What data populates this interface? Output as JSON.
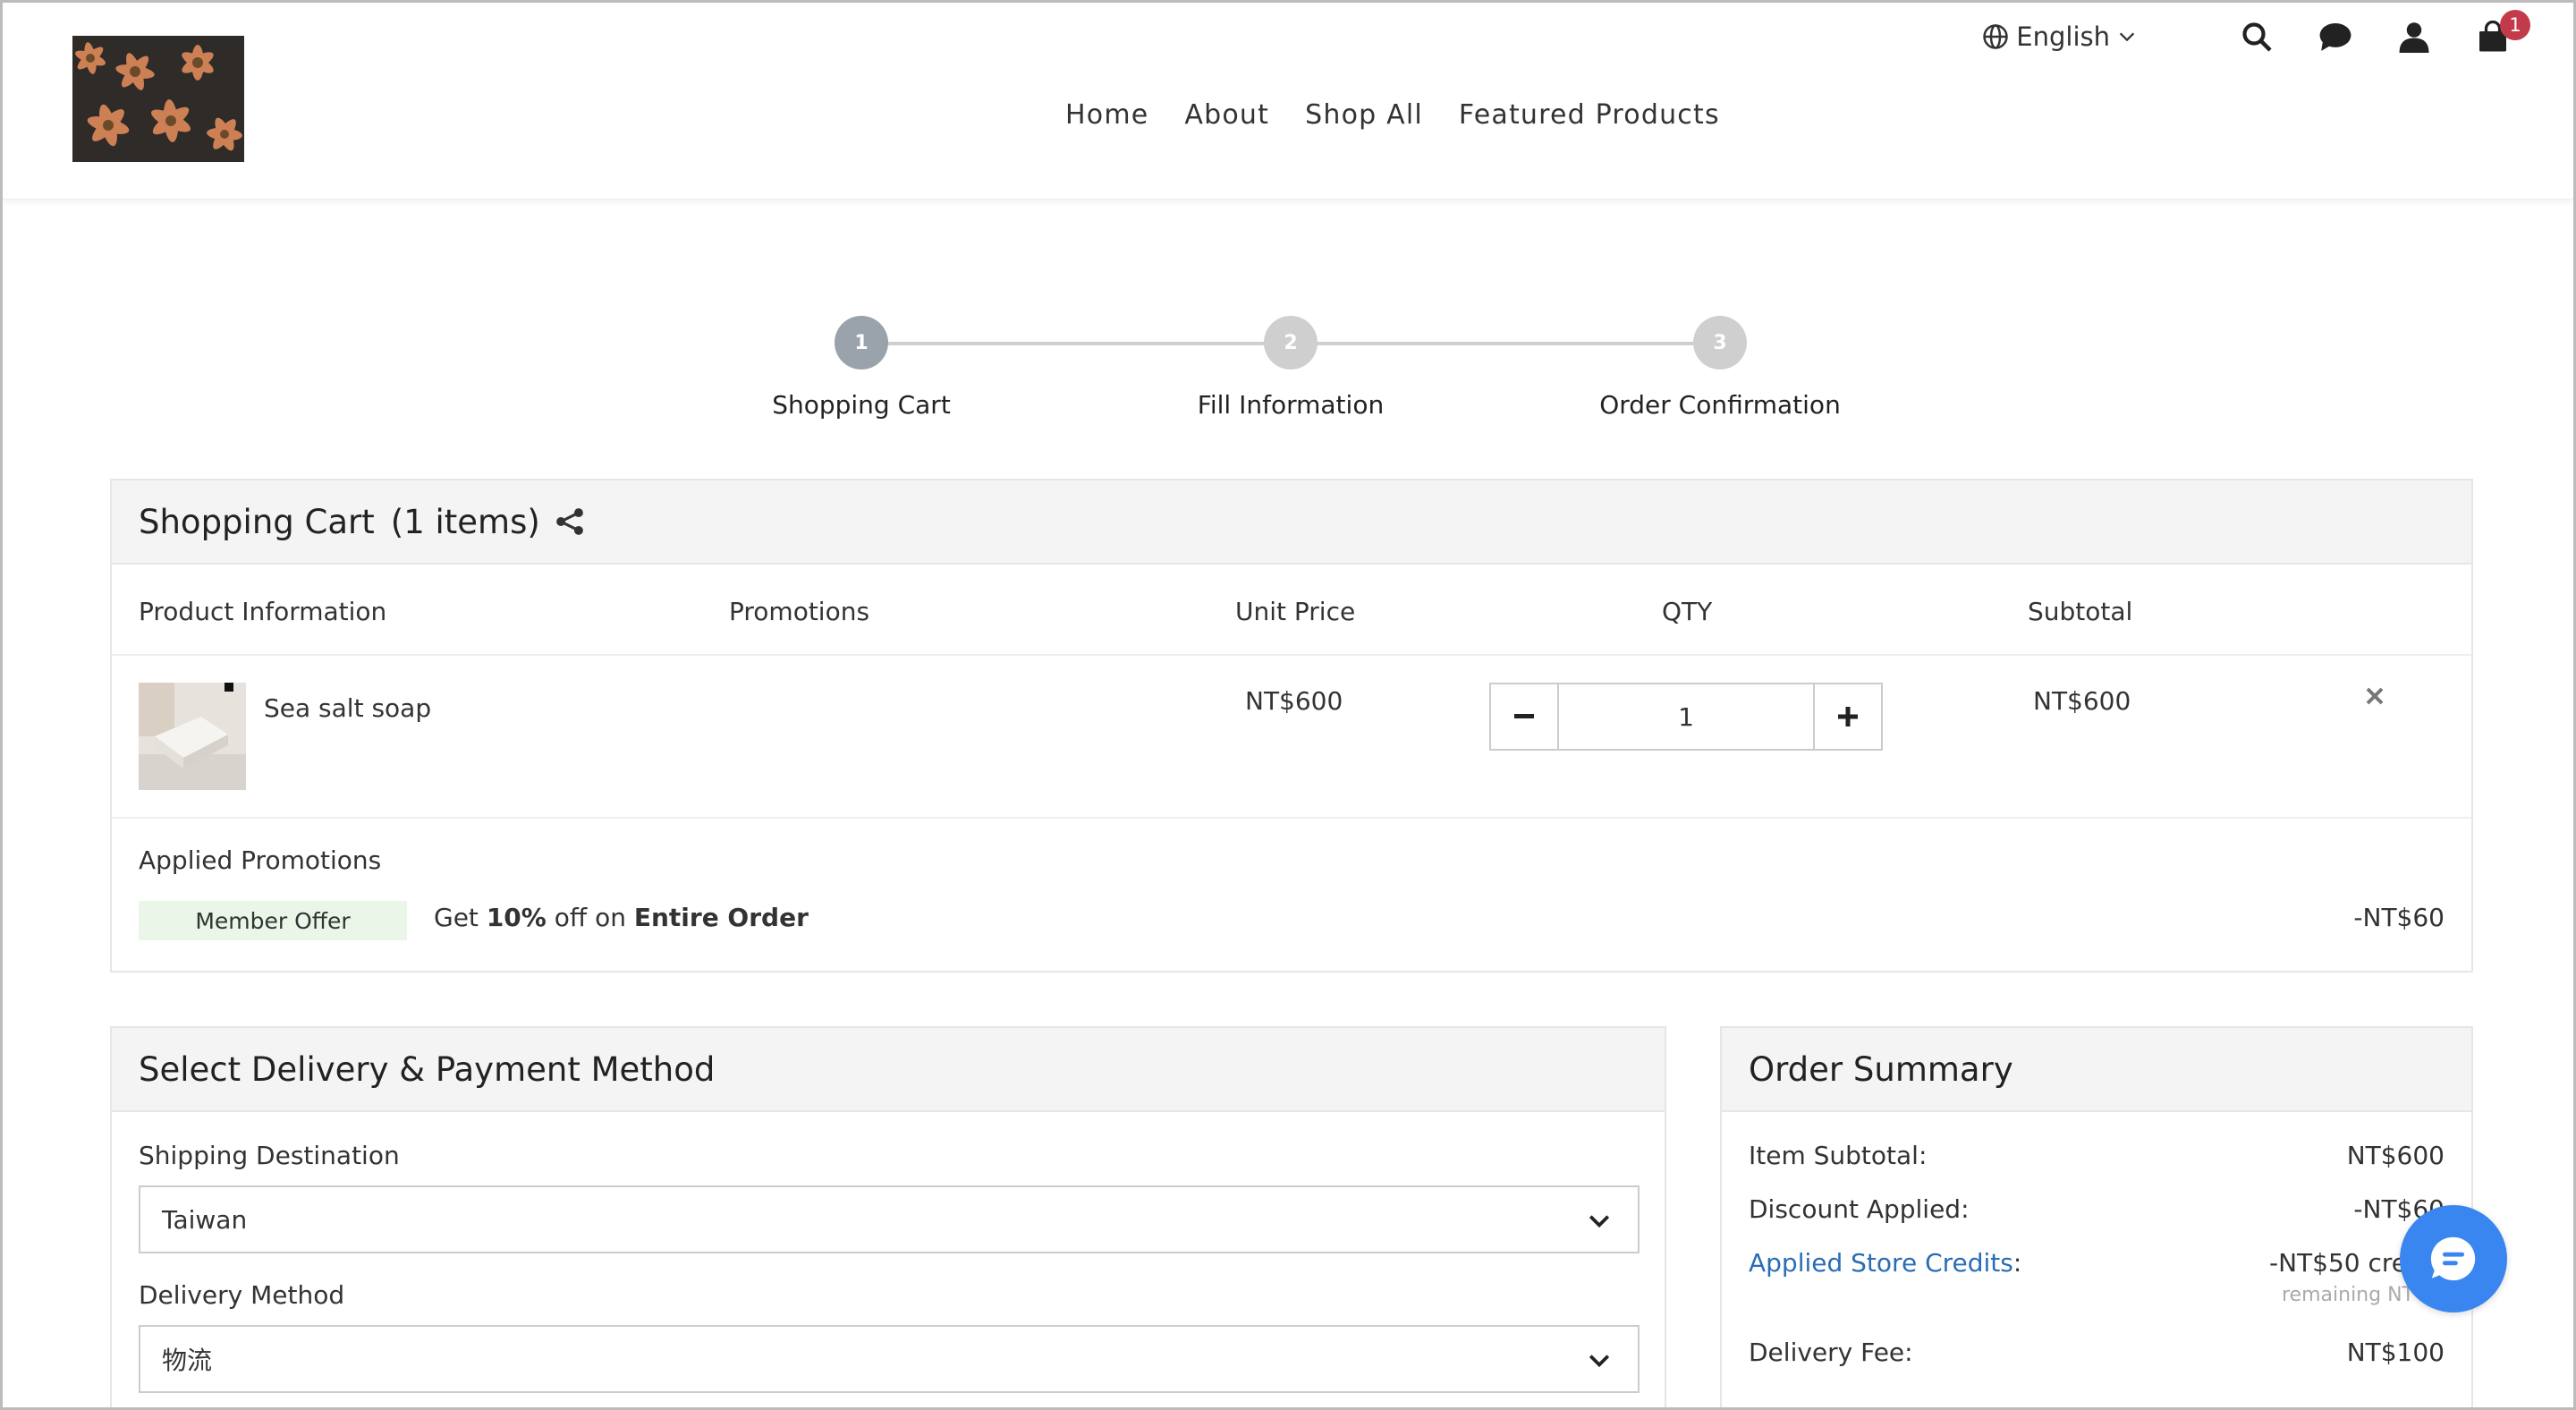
{
  "header": {
    "language": "English",
    "cart_count": "1",
    "nav": [
      "Home",
      "About",
      "Shop All",
      "Featured Products"
    ]
  },
  "stepper": {
    "steps": [
      {
        "num": "1",
        "label": "Shopping Cart",
        "color": "#9aa3ab"
      },
      {
        "num": "2",
        "label": "Fill Information",
        "color": "#cfcfcf"
      },
      {
        "num": "3",
        "label": "Order Confirmation",
        "color": "#cfcfcf"
      }
    ]
  },
  "cart": {
    "title": "Shopping Cart",
    "count": "(1 items)",
    "columns": {
      "product": "Product Information",
      "promotions": "Promotions",
      "unit_price": "Unit Price",
      "qty": "QTY",
      "subtotal": "Subtotal"
    },
    "item": {
      "name": "Sea salt soap",
      "unit_price": "NT$600",
      "qty": "1",
      "subtotal": "NT$600"
    },
    "applied_promotions": {
      "title": "Applied Promotions",
      "tag": "Member Offer",
      "text_prefix": "Get ",
      "percent": "10%",
      "text_mid": " off on ",
      "target": "Entire Order",
      "amount": "-NT$60"
    }
  },
  "delivery": {
    "title": "Select Delivery & Payment Method",
    "shipping_label": "Shipping Destination",
    "shipping_value": "Taiwan",
    "method_label": "Delivery Method",
    "method_value": "物流"
  },
  "summary": {
    "title": "Order Summary",
    "item_subtotal_label": "Item Subtotal:",
    "item_subtotal_value": "NT$600",
    "discount_label": "Discount Applied:",
    "discount_value": "-NT$60",
    "credits_label": "Applied Store Credits",
    "credits_colon": ":",
    "credits_value": "-NT$50 cre",
    "credits_sub": "remaining NT",
    "delivery_label": "Delivery Fee:",
    "delivery_value": "NT$100"
  },
  "colors": {
    "accent_blue": "#3a86f0",
    "link_blue": "#2a6db5",
    "badge_red": "#c23b4b",
    "promo_green": "#e9f6e8"
  }
}
